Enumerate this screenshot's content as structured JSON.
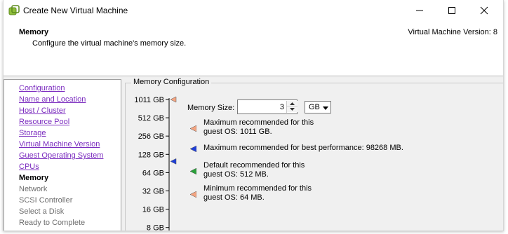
{
  "window": {
    "title": "Create New Virtual Machine",
    "controls": {
      "minimize": "minimize",
      "maximize": "maximize",
      "close": "close"
    }
  },
  "header": {
    "title": "Memory",
    "subtitle": "Configure the virtual machine's memory size.",
    "version": "Virtual Machine Version: 8"
  },
  "steps": [
    {
      "label": "Configuration",
      "state": "link"
    },
    {
      "label": "Name and Location",
      "state": "link"
    },
    {
      "label": "Host / Cluster",
      "state": "link"
    },
    {
      "label": "Resource Pool",
      "state": "link"
    },
    {
      "label": "Storage",
      "state": "link"
    },
    {
      "label": "Virtual Machine Version",
      "state": "link"
    },
    {
      "label": "Guest Operating System",
      "state": "link"
    },
    {
      "label": "CPUs",
      "state": "link"
    },
    {
      "label": "Memory",
      "state": "current"
    },
    {
      "label": "Network",
      "state": "future"
    },
    {
      "label": "SCSI Controller",
      "state": "future"
    },
    {
      "label": "Select a Disk",
      "state": "future"
    },
    {
      "label": "Ready to Complete",
      "state": "future"
    }
  ],
  "memory_config": {
    "group_title": "Memory Configuration",
    "size_label": "Memory Size:",
    "size_value": "3",
    "unit_selected": "GB",
    "scale_labels": [
      "1011 GB",
      "512 GB",
      "256 GB",
      "128 GB",
      "64 GB",
      "32 GB",
      "16 GB",
      "8 GB"
    ],
    "recommendations": [
      {
        "id": "max-guest",
        "icon": "triangle-left-icon",
        "color": "#f4a582",
        "text_line1": "Maximum recommended for this",
        "text_line2": "guest OS: 1011 GB."
      },
      {
        "id": "max-perf",
        "icon": "triangle-left-icon",
        "color": "#1f3fd8",
        "text_line1": "Maximum recommended for best performance: 98268 MB.",
        "text_line2": ""
      },
      {
        "id": "default",
        "icon": "triangle-left-icon",
        "color": "#2aa03a",
        "text_line1": "Default recommended for this",
        "text_line2": "guest OS: 512 MB."
      },
      {
        "id": "min",
        "icon": "triangle-left-icon",
        "color": "#f4a582",
        "text_line1": "Minimum recommended for this",
        "text_line2": "guest OS: 64 MB."
      }
    ]
  }
}
